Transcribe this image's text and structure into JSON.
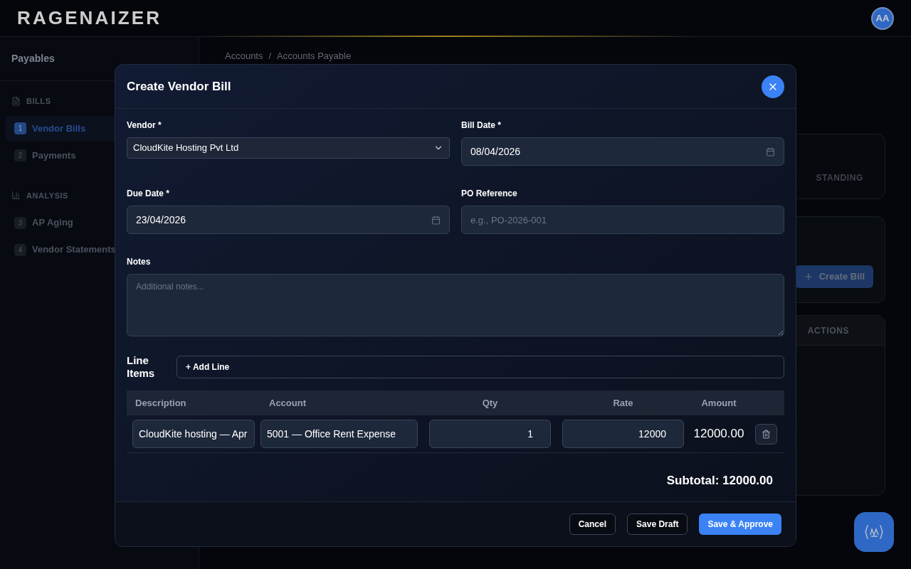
{
  "header": {
    "logo": "RAGENAIZER",
    "avatar": "AA"
  },
  "sidebar": {
    "title": "Payables",
    "sections": [
      {
        "label": "BILLS",
        "items": [
          {
            "number": "1",
            "label": "Vendor Bills",
            "selected": true
          },
          {
            "number": "2",
            "label": "Payments",
            "selected": false
          }
        ]
      },
      {
        "label": "ANALYSIS",
        "items": [
          {
            "number": "3",
            "label": "AP Aging",
            "selected": false
          },
          {
            "number": "4",
            "label": "Vendor Statements",
            "selected": false
          }
        ]
      }
    ]
  },
  "breadcrumb": {
    "items": [
      "Accounts",
      "Accounts Payable"
    ],
    "separator": "/"
  },
  "background": {
    "stat_label": "STANDING",
    "create_button": "Create Bill",
    "table_header": "ACTIONS"
  },
  "modal": {
    "title": "Create Vendor Bill",
    "fields": [
      {
        "kind": "select",
        "label": "Vendor *",
        "value": "CloudKite Hosting Pvt Ltd"
      },
      {
        "kind": "date",
        "label": "Bill Date *",
        "value": "08/04/2026"
      },
      {
        "kind": "date",
        "label": "Due Date *",
        "value": "23/04/2026"
      },
      {
        "kind": "text",
        "label": "PO Reference",
        "placeholder": "e.g., PO-2026-001"
      },
      {
        "kind": "textarea",
        "label": "Notes",
        "placeholder": "Additional notes..."
      }
    ],
    "line_items": {
      "label": "Line Items",
      "add_button": "+ Add Line",
      "columns": [
        "Description",
        "Account",
        "Qty",
        "Rate",
        "Amount"
      ],
      "rows": [
        {
          "description": "CloudKite hosting — Apr",
          "account": "5001 — Office Rent Expense",
          "qty": "1",
          "rate": "12000",
          "amount": "12000.00"
        }
      ],
      "subtotal": "Subtotal: 12000.00"
    },
    "buttons": [
      {
        "label": "Cancel",
        "kind": "outline"
      },
      {
        "label": "Save Draft",
        "kind": "outline"
      },
      {
        "label": "Save & Approve",
        "kind": "primary"
      }
    ]
  }
}
